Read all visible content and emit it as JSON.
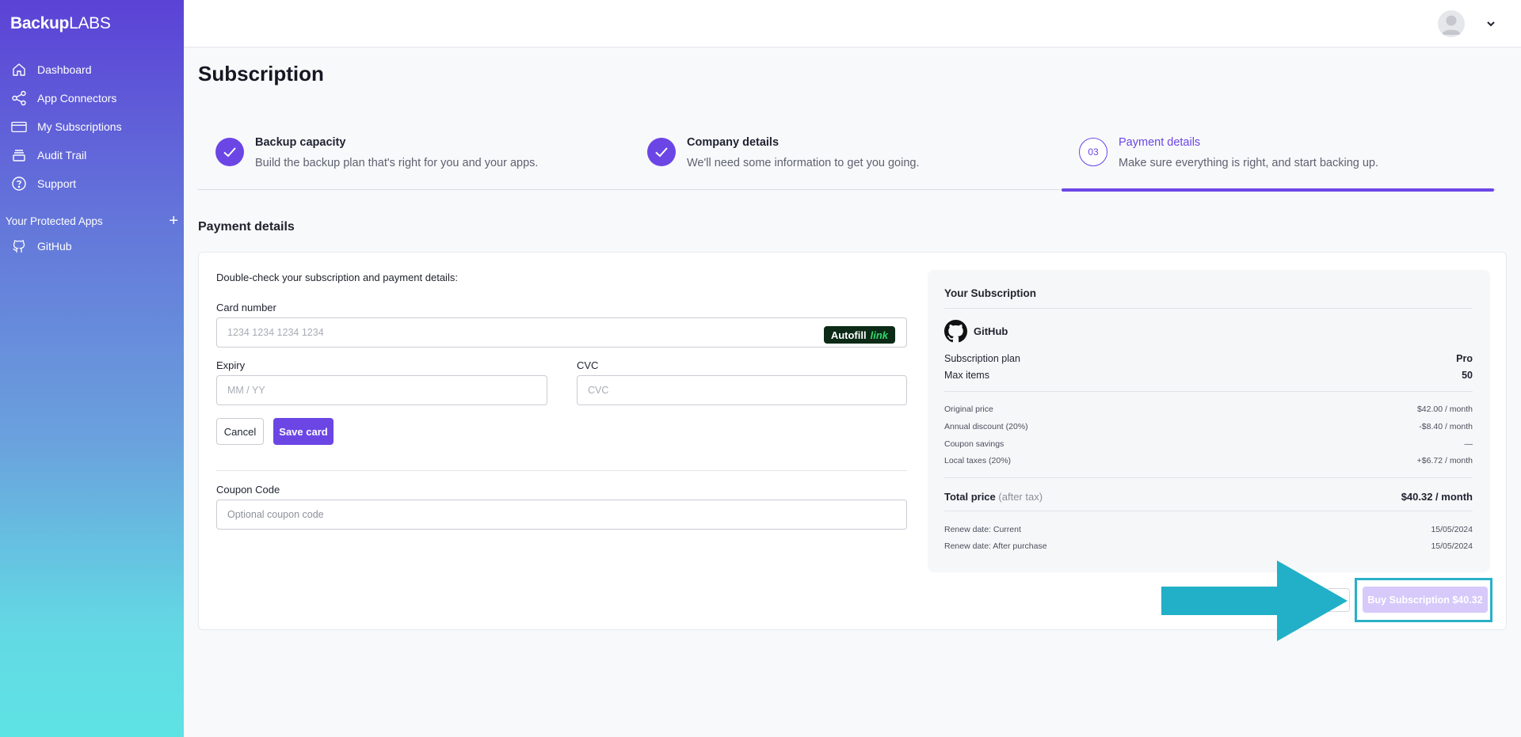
{
  "brand": {
    "part1": "Backup",
    "part2": "LABS"
  },
  "nav": [
    {
      "label": "Dashboard",
      "icon": "home-icon"
    },
    {
      "label": "App Connectors",
      "icon": "share-icon"
    },
    {
      "label": "My Subscriptions",
      "icon": "card-icon"
    },
    {
      "label": "Audit Trail",
      "icon": "stack-icon"
    },
    {
      "label": "Support",
      "icon": "help-icon"
    }
  ],
  "protected_apps": {
    "heading": "Your Protected Apps",
    "add": "+",
    "items": [
      {
        "label": "GitHub",
        "icon": "github-icon"
      }
    ]
  },
  "page": {
    "title": "Subscription"
  },
  "steps": [
    {
      "title": "Backup capacity",
      "desc": "Build the backup plan that's right for you and your apps.",
      "state": "done"
    },
    {
      "title": "Company details",
      "desc": "We'll need some information to get you going.",
      "state": "done"
    },
    {
      "number": "03",
      "title": "Payment details",
      "desc": "Make sure everything is right, and start backing up.",
      "state": "current"
    }
  ],
  "payment": {
    "section_title": "Payment details",
    "intro": "Double-check your subscription and payment details:",
    "card_label": "Card number",
    "card_placeholder": "1234 1234 1234 1234",
    "autofill": "Autofill",
    "autofill_link": "link",
    "expiry_label": "Expiry",
    "expiry_placeholder": "MM / YY",
    "cvc_label": "CVC",
    "cvc_placeholder": "CVC",
    "cancel": "Cancel",
    "save": "Save card",
    "coupon_label": "Coupon Code",
    "coupon_placeholder": "Optional coupon code"
  },
  "summary": {
    "title": "Your Subscription",
    "app": "GitHub",
    "plan_label": "Subscription plan",
    "plan_value": "Pro",
    "max_label": "Max items",
    "max_value": "50",
    "original_label": "Original price",
    "original_value": "$42.00 / month",
    "discount_label": "Annual discount (20%)",
    "discount_value": "-$8.40 / month",
    "coupon_label": "Coupon savings",
    "coupon_value": "—",
    "tax_label": "Local taxes (20%)",
    "tax_value": "+$6.72 / month",
    "total_label": "Total price",
    "total_note": "(after tax)",
    "total_value": "$40.32 / month",
    "renew_current_label": "Renew date: Current",
    "renew_current_value": "15/05/2024",
    "renew_after_label": "Renew date: After purchase",
    "renew_after_value": "15/05/2024"
  },
  "actions": {
    "buy": "Buy Subscription $40.32"
  },
  "colors": {
    "accent": "#6b46e5",
    "highlight": "#2ab0c7",
    "arrow": "#21b0c8"
  }
}
